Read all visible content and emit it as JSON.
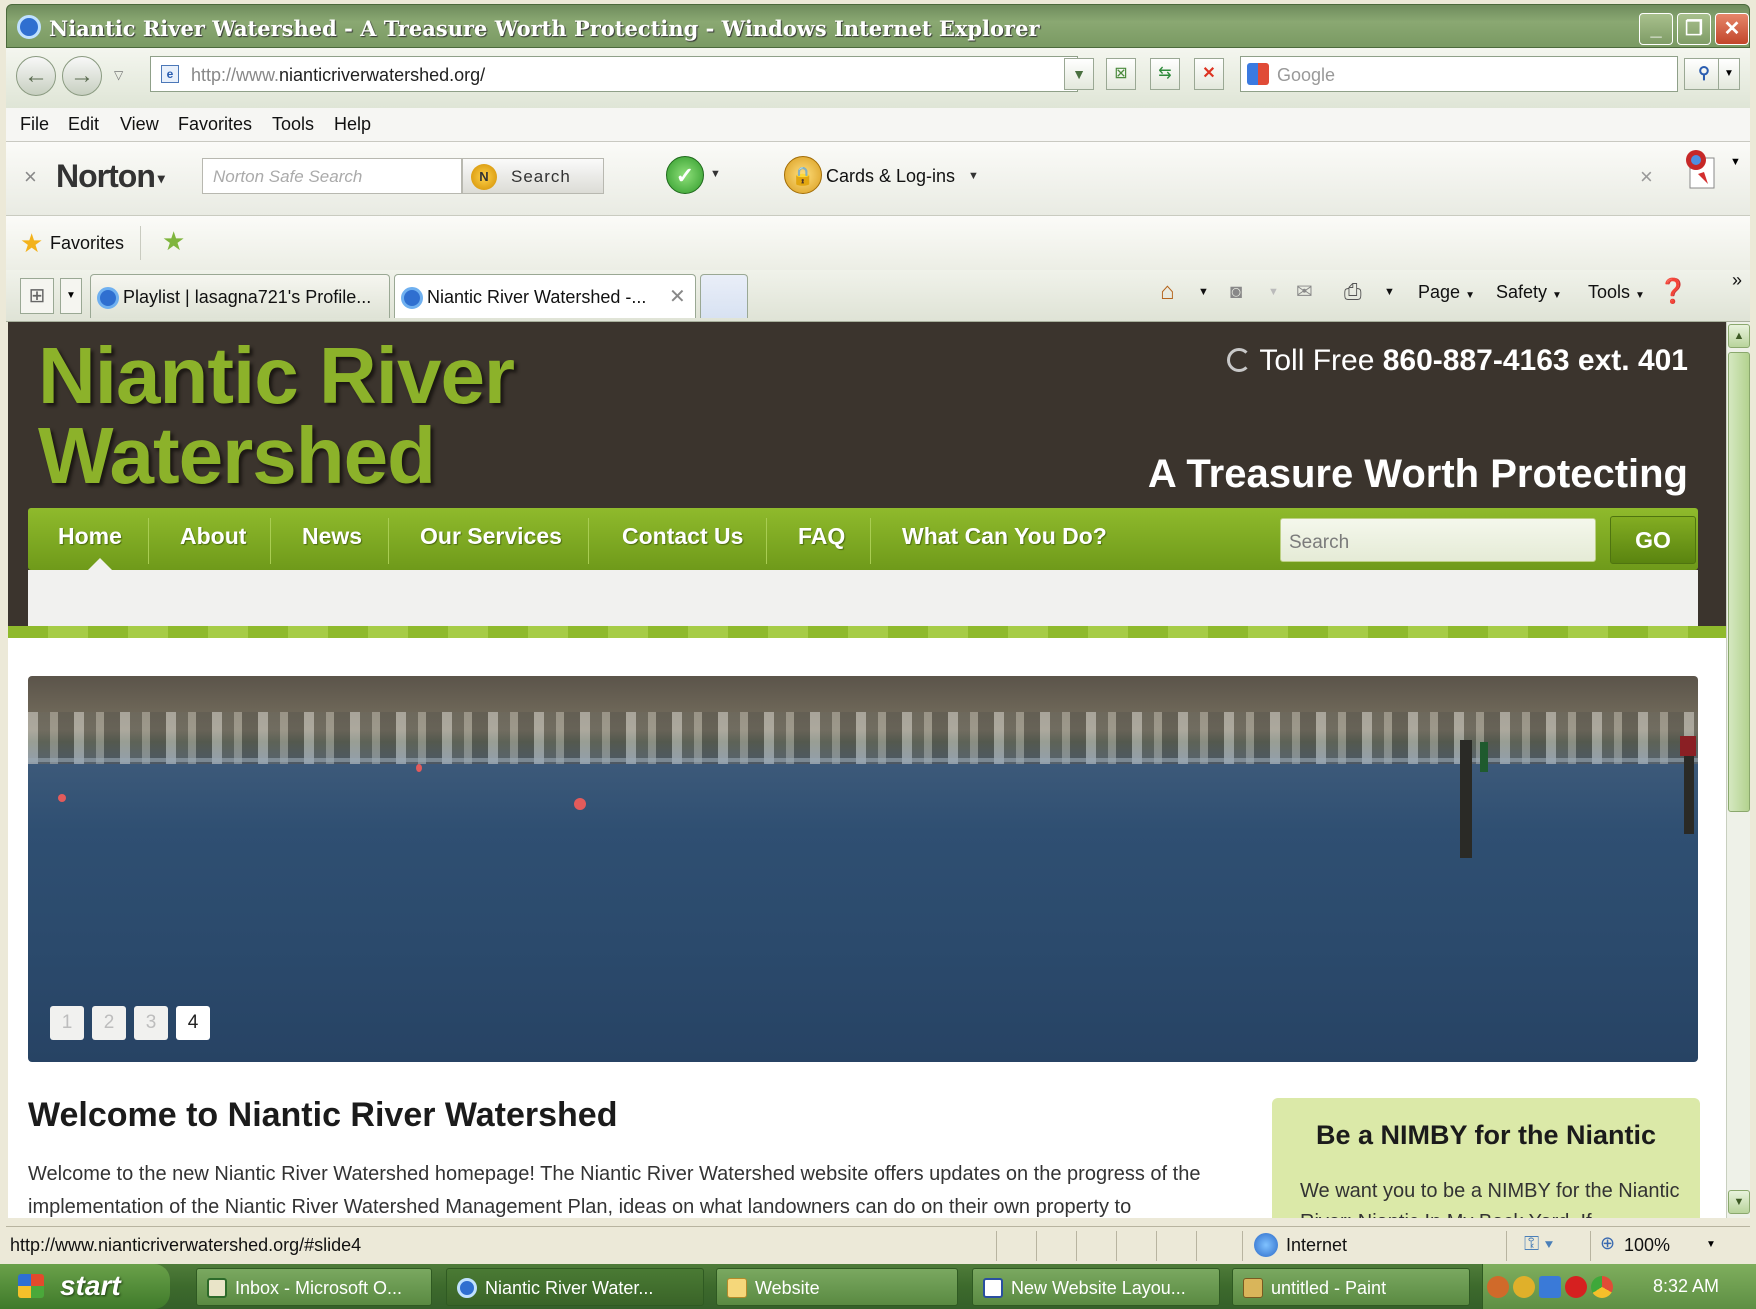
{
  "window": {
    "title": "Niantic River Watershed - A Treasure Worth Protecting - Windows Internet Explorer",
    "min_label": "_",
    "max_label": "❐",
    "close_label": "✕"
  },
  "addressbar": {
    "url_prefix": "http://www.",
    "url_domain": "nianticriverwatershed.org/",
    "search_placeholder": "Google"
  },
  "menu": [
    "File",
    "Edit",
    "View",
    "Favorites",
    "Tools",
    "Help"
  ],
  "norton": {
    "logo": "Norton",
    "search_placeholder": "Norton Safe Search",
    "search_button": "Search",
    "cards_label": "Cards & Log-ins"
  },
  "favorites": {
    "label": "Favorites"
  },
  "tabs": [
    {
      "label": "Playlist | lasagna721's Profile..."
    },
    {
      "label": "Niantic River Watershed -..."
    }
  ],
  "commandbar": {
    "page": "Page",
    "safety": "Safety",
    "tools": "Tools",
    "chevron": "»"
  },
  "site": {
    "logo_line1": "Niantic River",
    "logo_line2": "Watershed",
    "toll_free_label": "Toll Free",
    "toll_free_number": "860-887-4163 ext. 401",
    "tagline": "A Treasure Worth Protecting",
    "nav": [
      "Home",
      "About",
      "News",
      "Our Services",
      "Contact Us",
      "FAQ",
      "What Can You Do?"
    ],
    "search_placeholder": "Search",
    "go_label": "GO",
    "slider_pages": [
      "1",
      "2",
      "3",
      "4"
    ],
    "slider_active": 4,
    "welcome_title": "Welcome to Niantic River Watershed",
    "welcome_text": "Welcome to the new Niantic River Watershed homepage! The Niantic River Watershed website offers updates on the progress of the implementation of the Niantic River Watershed Management Plan, ideas on what landowners can do on their own property to",
    "nimby_title": "Be a NIMBY for the Niantic",
    "nimby_text": "We want you to be a NIMBY for the Niantic River: Niantic In My Back Yard. If"
  },
  "statusbar": {
    "url": "http://www.nianticriverwatershed.org/#slide4",
    "zone": "Internet",
    "zoom": "100%"
  },
  "taskbar": {
    "start": "start",
    "items": [
      {
        "label": "Inbox - Microsoft O..."
      },
      {
        "label": "Niantic River Water..."
      },
      {
        "label": "Website"
      },
      {
        "label": "New Website Layou..."
      },
      {
        "label": "untitled - Paint"
      }
    ],
    "clock": "8:32 AM"
  },
  "colors": {
    "site_green": "#8cb22a",
    "header_brown": "#3b342d",
    "nimby_bg": "#dbe9a8"
  }
}
